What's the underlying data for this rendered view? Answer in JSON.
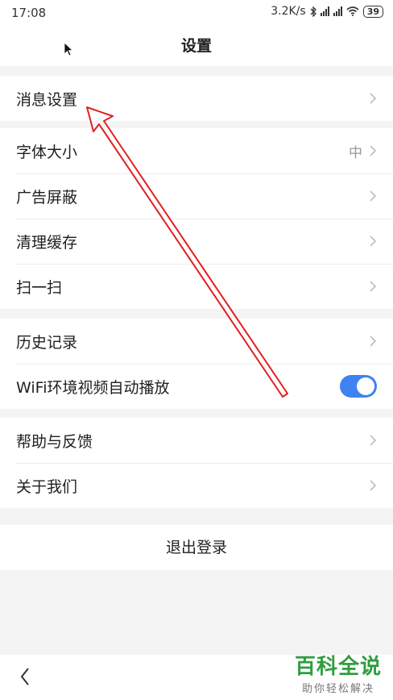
{
  "status": {
    "time": "17:08",
    "network_speed": "3.2K/s",
    "battery": "39"
  },
  "header": {
    "title": "设置"
  },
  "groups": [
    {
      "items": [
        {
          "label": "消息设置"
        }
      ]
    },
    {
      "items": [
        {
          "label": "字体大小",
          "value": "中"
        },
        {
          "label": "广告屏蔽"
        },
        {
          "label": "清理缓存"
        },
        {
          "label": "扫一扫"
        }
      ]
    },
    {
      "items": [
        {
          "label": "历史记录"
        },
        {
          "label": "WiFi环境视频自动播放",
          "toggle": "on"
        }
      ]
    },
    {
      "items": [
        {
          "label": "帮助与反馈"
        },
        {
          "label": "关于我们"
        }
      ]
    }
  ],
  "logout": {
    "label": "退出登录"
  },
  "watermark": {
    "logo": "百科全说",
    "subtitle": "助你轻松解决"
  },
  "colors": {
    "toggle_on": "#3f82f1",
    "annotation_arrow": "#e02020",
    "chevron": "#bdbdbd"
  },
  "icons": {
    "back": "chevron-left-icon",
    "row_chevron": "chevron-right-icon",
    "cursor": "mouse-pointer-icon"
  }
}
